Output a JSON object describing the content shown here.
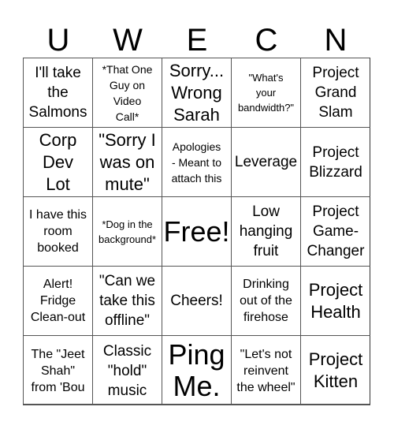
{
  "header": {
    "letters": [
      "U",
      "W",
      "E",
      "C",
      "N"
    ]
  },
  "cells": [
    {
      "text": "I'll take\nthe\nSalmons",
      "size": "s-md"
    },
    {
      "text": "*That One\nGuy on\nVideo\nCall*",
      "size": "s-xs"
    },
    {
      "text": "Sorry...\nWrong\nSarah",
      "size": "s-lg"
    },
    {
      "text": "\"What's\nyour\nbandwidth?\"",
      "size": "s-xxs"
    },
    {
      "text": "Project\nGrand\nSlam",
      "size": "s-md"
    },
    {
      "text": "Corp\nDev\nLot",
      "size": "s-lg"
    },
    {
      "text": "\"Sorry I\nwas on\nmute\"",
      "size": "s-lg"
    },
    {
      "text": "Apologies\n- Meant to\nattach this",
      "size": "s-xs"
    },
    {
      "text": "Leverage",
      "size": "s-md"
    },
    {
      "text": "Project\nBlizzard",
      "size": "s-md"
    },
    {
      "text": "I have this\nroom\nbooked",
      "size": "s-sm"
    },
    {
      "text": "*Dog in the\nbackground*",
      "size": "s-xxs"
    },
    {
      "text": "Free!",
      "size": "s-xl"
    },
    {
      "text": "Low\nhanging\nfruit",
      "size": "s-md"
    },
    {
      "text": "Project\nGame-\nChanger",
      "size": "s-md"
    },
    {
      "text": "Alert!\nFridge\nClean-out",
      "size": "s-sm"
    },
    {
      "text": "\"Can we\ntake this\noffline\"",
      "size": "s-md"
    },
    {
      "text": "Cheers!",
      "size": "s-md"
    },
    {
      "text": "Drinking\nout of the\nfirehose",
      "size": "s-sm"
    },
    {
      "text": "Project\nHealth",
      "size": "s-lg"
    },
    {
      "text": "The \"Jeet\nShah\"\nfrom 'Bou",
      "size": "s-sm"
    },
    {
      "text": "Classic\n\"hold\"\nmusic",
      "size": "s-md"
    },
    {
      "text": "Ping\nMe.",
      "size": "s-xl"
    },
    {
      "text": "\"Let's not\nreinvent\nthe wheel\"",
      "size": "s-sm"
    },
    {
      "text": "Project\nKitten",
      "size": "s-lg"
    }
  ]
}
